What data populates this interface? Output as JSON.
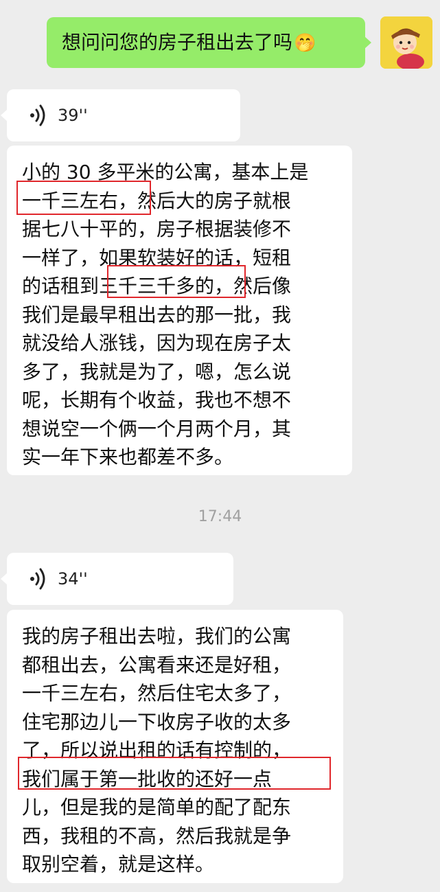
{
  "sent_message": {
    "text": "想问问您的房子租出去了吗",
    "emoji": "🤭"
  },
  "voice_message_1": {
    "duration": "39''",
    "transcript_lines": [
      "小的 30 多平米的公寓，基本上是",
      "一千三左右，然后大的房子就根",
      "据七八十平的，房子根据装修不",
      "一样了，如果软装好的话，短租",
      "的话租到三千三千多的，然后像",
      "我们是最早租出去的那一批，我",
      "就没给人涨钱，因为现在房子太",
      "多了，我就是为了，嗯，怎么说",
      "呢，长期有个收益，我也不想不",
      "想说空一个俩一个月两个月，其",
      "实一年下来也都差不多。"
    ]
  },
  "timestamp": "17:44",
  "voice_message_2": {
    "duration": "34''",
    "transcript_lines": [
      "我的房子租出去啦，我们的公寓",
      "都租出去，公寓看来还是好租，",
      "一千三左右，然后住宅太多了，",
      "住宅那边儿一下收房子收的太多",
      "了，所以说出租的话有控制的，",
      "我们属于第一批收的还好一点",
      "儿，但是我的是简单的配了配东",
      "西，我租的不高，然后我就是争",
      "取别空着，就是这样。"
    ]
  },
  "colors": {
    "background": "#ededed",
    "sent_bubble": "#95ec69",
    "received_bubble": "#ffffff",
    "highlight_box": "#e0262b",
    "timestamp_text": "#a0a0a0"
  },
  "icons": {
    "voice": "voice-wave-icon",
    "avatar": "cartoon-avatar"
  }
}
